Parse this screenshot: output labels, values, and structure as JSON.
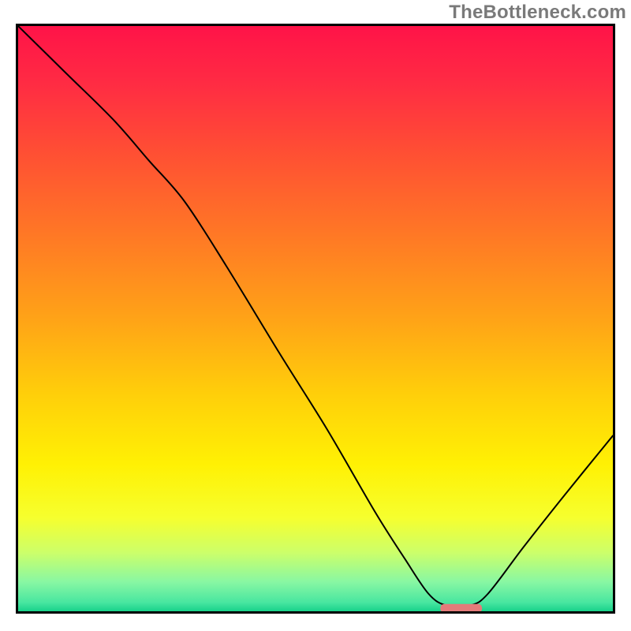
{
  "watermark": "TheBottleneck.com",
  "chart_data": {
    "type": "line",
    "title": "",
    "xlabel": "",
    "ylabel": "",
    "xlim": [
      0,
      100
    ],
    "ylim": [
      0,
      100
    ],
    "grid": false,
    "legend": false,
    "gradient_stops": [
      {
        "offset": 0.0,
        "color": "#ff1348"
      },
      {
        "offset": 0.1,
        "color": "#ff2c43"
      },
      {
        "offset": 0.22,
        "color": "#ff5033"
      },
      {
        "offset": 0.35,
        "color": "#ff7626"
      },
      {
        "offset": 0.5,
        "color": "#ffa317"
      },
      {
        "offset": 0.63,
        "color": "#ffcf0a"
      },
      {
        "offset": 0.75,
        "color": "#fff104"
      },
      {
        "offset": 0.84,
        "color": "#f6ff2e"
      },
      {
        "offset": 0.9,
        "color": "#ccff6a"
      },
      {
        "offset": 0.95,
        "color": "#88f7a3"
      },
      {
        "offset": 0.985,
        "color": "#48e6a0"
      },
      {
        "offset": 1.0,
        "color": "#18d18a"
      }
    ],
    "series": [
      {
        "name": "curve",
        "type": "line",
        "color": "#000000",
        "width": 2,
        "x": [
          0.0,
          8.0,
          16.0,
          22.0,
          28.0,
          35.0,
          44.0,
          52.0,
          60.0,
          65.0,
          69.0,
          72.0,
          76.0,
          79.0,
          85.0,
          92.0,
          100.0
        ],
        "y": [
          100.0,
          92.0,
          84.0,
          77.0,
          70.0,
          59.0,
          44.0,
          31.0,
          17.0,
          9.0,
          3.0,
          1.0,
          1.0,
          3.0,
          11.0,
          20.0,
          30.0
        ]
      },
      {
        "name": "marker-flat-region",
        "type": "marker",
        "shape": "rounded-rect",
        "color": "#e47b7a",
        "x_range": [
          71.0,
          78.0
        ],
        "y": 0.5,
        "height_fraction": 0.015
      }
    ],
    "axes_visible": false,
    "frame": {
      "color": "#000000",
      "width": 3
    }
  }
}
